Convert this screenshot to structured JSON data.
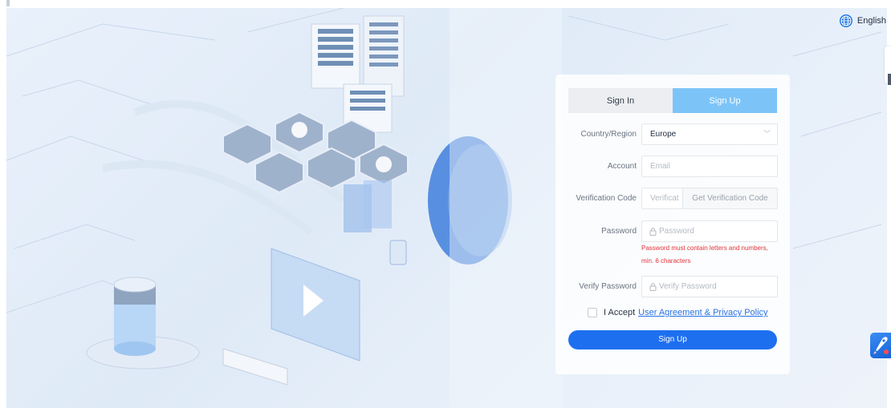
{
  "language": {
    "label": "English",
    "icon": "globe-icon"
  },
  "auth": {
    "tabs": [
      {
        "label": "Sign In",
        "active": false
      },
      {
        "label": "Sign Up",
        "active": true
      }
    ],
    "form": {
      "country": {
        "label": "Country/Region",
        "value": "Europe"
      },
      "account": {
        "label": "Account",
        "placeholder": "Email"
      },
      "verification": {
        "label": "Verification Code",
        "placeholder": "Verificat",
        "button": "Get Verification Code"
      },
      "password": {
        "label": "Password",
        "placeholder": "Password",
        "error_line1": "Password must contain letters and numbers,",
        "error_line2": "min. 6 characters"
      },
      "verify_password": {
        "label": "Verify Password",
        "placeholder": "Verify Password"
      }
    },
    "agreement": {
      "prefix": "I Accept",
      "link": "User Agreement & Privacy Policy",
      "checked": false
    },
    "submit": "Sign Up"
  },
  "colors": {
    "accent": "#1e6ff0",
    "tab_active": "#7cc4f8",
    "error": "#e5333a",
    "link": "#2a72e6"
  }
}
